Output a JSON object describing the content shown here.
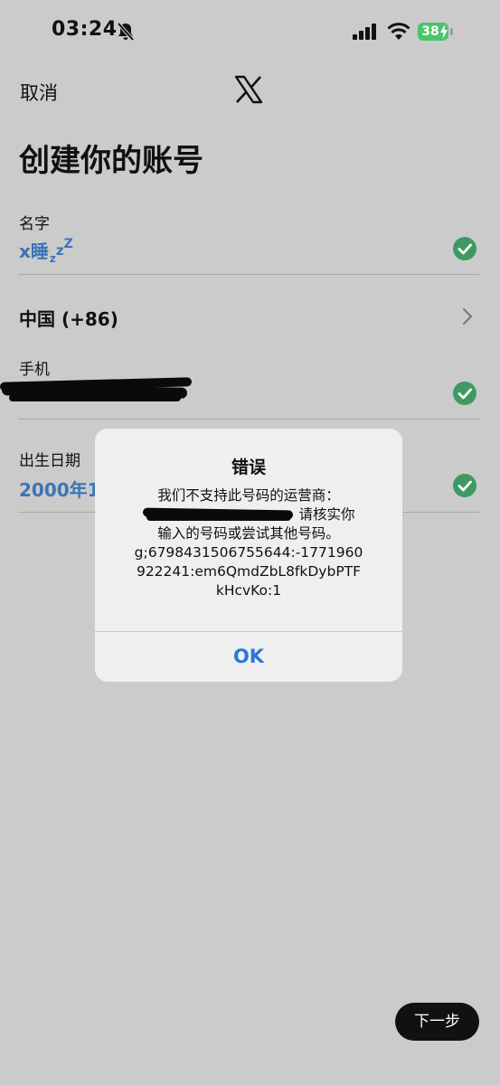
{
  "status_bar": {
    "time": "03:24",
    "battery": "38",
    "battery_color": "#4bc46a"
  },
  "header": {
    "cancel_label": "取消",
    "logo_icon": "x-logo-icon"
  },
  "page": {
    "title": "创建你的账号"
  },
  "form": {
    "name_label": "名字",
    "name_value": "x睡",
    "name_suffix_z1": "z",
    "name_suffix_z2": "z",
    "name_suffix_z3": "Z",
    "country": "中国 (+86)",
    "phone_label": "手机",
    "birth_label": "出生日期",
    "birth_value": "2000年1"
  },
  "dialog": {
    "title": "错误",
    "line1": "我们不支持此号码的运营商：",
    "line2_tail": "请核实你",
    "line3": "输入的号码或尝试其他号码。",
    "line4": "g;6798431506755644:-1771960",
    "line5": "922241:em6QmdZbL8fkDybPTF",
    "line6": "kHcvKo:1",
    "ok_label": "OK"
  },
  "footer": {
    "next_label": "下一步"
  },
  "colors": {
    "accent": "#2f74db",
    "link_value": "#3b74b8",
    "check_green": "#3e9a63"
  }
}
